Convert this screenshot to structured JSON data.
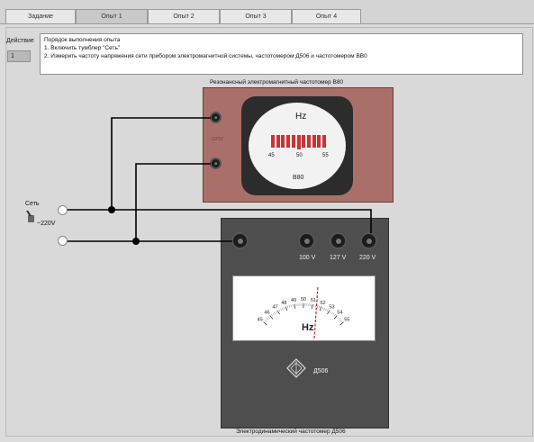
{
  "tabs": [
    {
      "label": "Задание"
    },
    {
      "label": "Опыт 1"
    },
    {
      "label": "Опыт 2"
    },
    {
      "label": "Опыт 3"
    },
    {
      "label": "Опыт 4"
    }
  ],
  "step": {
    "label": "Действие",
    "value": "1"
  },
  "instructions": [
    "Порядок выполнения опыта",
    "1. Включить тумблер \"Сеть\"",
    "2. Измерить частоту напряжения сети прибором электромагнитной системы, частотомером Д506 и частотомером ВВ0"
  ],
  "freqmeter": {
    "caption": "Резонансный электромагнитный частотомер В80",
    "hz_label": "Hz",
    "scale": [
      "45",
      "50",
      "55"
    ],
    "model": "В80",
    "side_label": "~220V"
  },
  "network": {
    "switch_label": "Сеть",
    "voltage": "~220V"
  },
  "d506": {
    "ranges": [
      "100 V",
      "127 V",
      "220 V"
    ],
    "scale_ticks": [
      "45",
      "46",
      "47",
      "48",
      "49",
      "50",
      "51",
      "52",
      "53",
      "54",
      "55"
    ],
    "hz_label": "Hz",
    "model": "Д506",
    "caption": "Электродинамический частотомер Д506"
  },
  "colors": {
    "freqmeter_body": "#a9706a",
    "d506_body": "#4e4e4e",
    "needle": "#cc2222",
    "reed": "#cc3333"
  },
  "icons": {
    "emblem": "diamond-logo-icon",
    "switch": "toggle-switch-icon"
  }
}
